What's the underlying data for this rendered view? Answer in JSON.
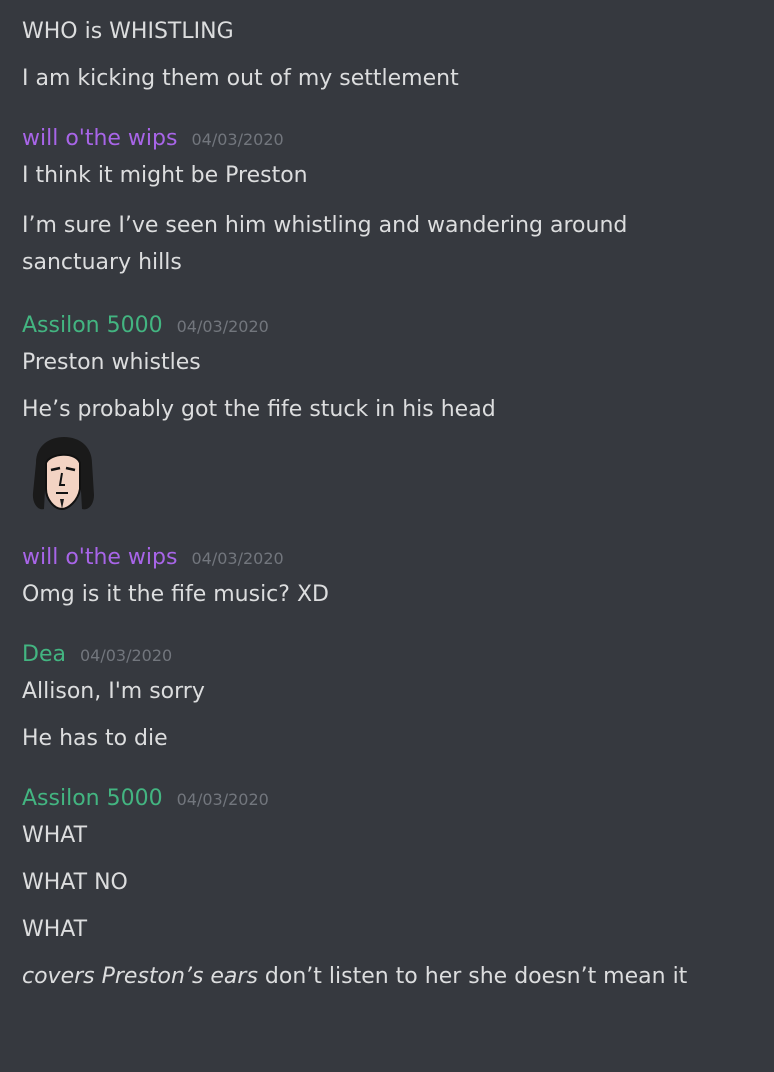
{
  "colors": {
    "background": "#36393f",
    "text": "#dcddde",
    "timestamp": "#72767d",
    "purple_user": "#a865e8",
    "green_user": "#43b581"
  },
  "messages": {
    "lead": [
      "WHO is WHISTLING",
      "I am kicking them out of my settlement"
    ],
    "g1": {
      "author": "will o'the wips",
      "timestamp": "04/03/2020",
      "lines": [
        "I think it might be Preston",
        "I’m sure I’ve seen him whistling and wandering around sanctuary hills"
      ]
    },
    "g2": {
      "author": "Assilon 5000",
      "timestamp": "04/03/2020",
      "lines": [
        "Preston whistles",
        "He’s probably got the fife stuck in his head"
      ],
      "emoji": "face-emoji"
    },
    "g3": {
      "author": "will o'the wips",
      "timestamp": "04/03/2020",
      "lines": [
        "Omg is it the fife music? XD"
      ]
    },
    "g4": {
      "author": "Dea",
      "timestamp": "04/03/2020",
      "lines": [
        "Allison, I'm sorry",
        "He has to die"
      ]
    },
    "g5": {
      "author": "Assilon 5000",
      "timestamp": "04/03/2020",
      "lines": [
        "WHAT",
        "WHAT NO",
        "WHAT"
      ],
      "last_italic": "covers Preston’s ears",
      "last_rest": " don’t listen to her she doesn’t mean it"
    }
  }
}
